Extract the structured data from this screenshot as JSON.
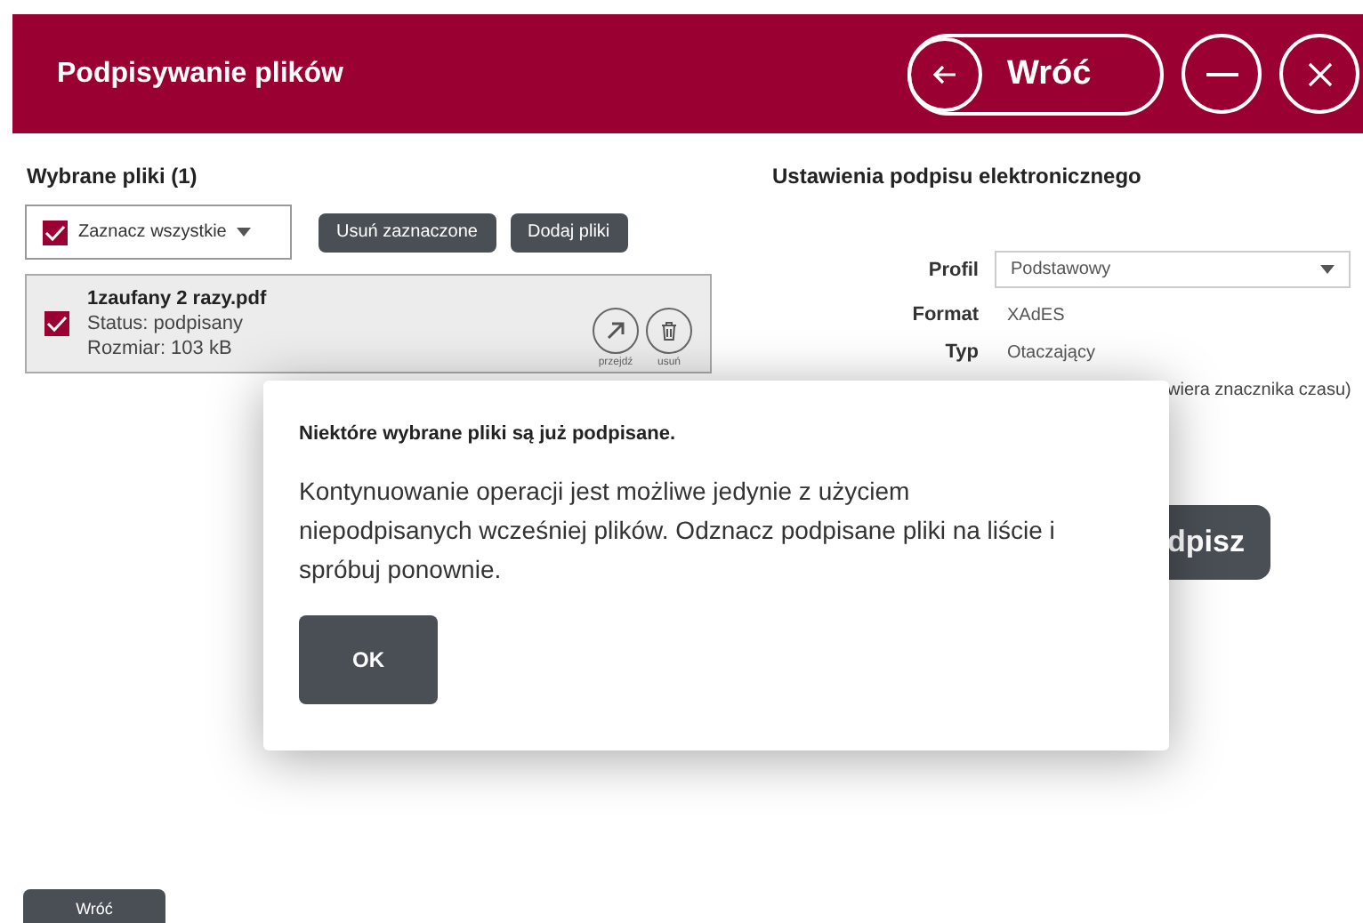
{
  "header": {
    "title": "Podpisywanie plików",
    "back_button": "Wróć"
  },
  "files": {
    "heading": "Wybrane pliki (1)",
    "select_all": {
      "label": "Zaznacz wszystkie",
      "checked": true
    },
    "buttons": [
      "Usuń zaznaczone",
      "Dodaj pliki"
    ],
    "items": [
      {
        "name": "1zaufany 2 razy.pdf",
        "status": "Status: podpisany",
        "size": "Rozmiar: 103 kB",
        "checked": true,
        "actions": [
          "przejdź",
          "usuń"
        ]
      }
    ]
  },
  "settings": {
    "heading": "Ustawienia podpisu elektronicznego",
    "profile_label": "Profil",
    "profile_value": "Podstawowy",
    "format_label": "Format",
    "format_value": "XAdES",
    "type_label": "Typ",
    "type_value": "Otaczający",
    "note": "wiera znacznika czasu)",
    "sign_button": "dpisz"
  },
  "dialog": {
    "title": "Niektóre wybrane pliki są już podpisane.",
    "message": "Kontynuowanie operacji jest możliwe jedynie z użyciem niepodpisanych wcześniej plików. Odznacz podpisane pliki na liście i spróbuj ponownie.",
    "ok_button": "OK"
  },
  "footer": {
    "back_button": "Wróć"
  }
}
